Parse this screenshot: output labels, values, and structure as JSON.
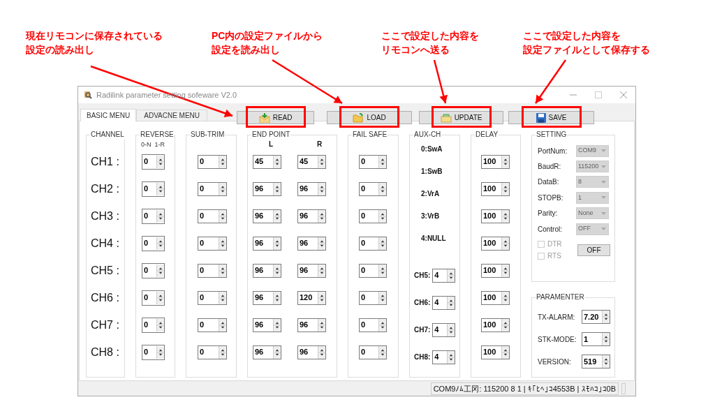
{
  "annotations": [
    {
      "lines": [
        "現在リモコンに保存されている",
        "設定の読み出し"
      ]
    },
    {
      "lines": [
        "PC内の設定ファイルから",
        "設定を読み出し"
      ]
    },
    {
      "lines": [
        "ここで設定した内容を",
        "リモコンへ送る"
      ]
    },
    {
      "lines": [
        "ここで設定した内容を",
        "設定ファイルとして保存する"
      ]
    }
  ],
  "window": {
    "title": "Radilink parameter setting sofeware V2.0"
  },
  "tabs": [
    {
      "label": "BASIC MENU",
      "selected": true
    },
    {
      "label": "ADVACNE MENU",
      "selected": false
    }
  ],
  "actions": [
    {
      "label": "READ",
      "kind": "read",
      "highlighted": true
    },
    {
      "label": "LOAD",
      "kind": "load",
      "highlighted": true
    },
    {
      "label": "UPDATE",
      "kind": "update",
      "highlighted": true
    },
    {
      "label": "SAVE",
      "kind": "save",
      "highlighted": true
    }
  ],
  "groups": {
    "channel": "CHANNEL",
    "reverse": "REVERSE",
    "reverse_hint": "0-N  1-R",
    "sub_trim": "SUB-TRIM",
    "end_point": "END POINT",
    "end_point_l": "L",
    "end_point_r": "R",
    "fail_safe": "FAIL SAFE",
    "aux_ch": "AUX-CH",
    "delay": "DELAY"
  },
  "channels": [
    {
      "label": "CH1 :",
      "reverse": "0",
      "sub_trim": "0",
      "end_point_l": "45",
      "end_point_r": "45",
      "fail_safe": "0",
      "delay": "100"
    },
    {
      "label": "CH2 :",
      "reverse": "0",
      "sub_trim": "0",
      "end_point_l": "96",
      "end_point_r": "96",
      "fail_safe": "0",
      "delay": "100"
    },
    {
      "label": "CH3 :",
      "reverse": "0",
      "sub_trim": "0",
      "end_point_l": "96",
      "end_point_r": "96",
      "fail_safe": "0",
      "delay": "100"
    },
    {
      "label": "CH4 :",
      "reverse": "0",
      "sub_trim": "0",
      "end_point_l": "96",
      "end_point_r": "96",
      "fail_safe": "0",
      "delay": "100"
    },
    {
      "label": "CH5 :",
      "reverse": "0",
      "sub_trim": "0",
      "end_point_l": "96",
      "end_point_r": "96",
      "fail_safe": "0",
      "delay": "100"
    },
    {
      "label": "CH6 :",
      "reverse": "0",
      "sub_trim": "0",
      "end_point_l": "96",
      "end_point_r": "120",
      "fail_safe": "0",
      "delay": "100"
    },
    {
      "label": "CH7 :",
      "reverse": "0",
      "sub_trim": "0",
      "end_point_l": "96",
      "end_point_r": "96",
      "fail_safe": "0",
      "delay": "100"
    },
    {
      "label": "CH8 :",
      "reverse": "0",
      "sub_trim": "0",
      "end_point_l": "96",
      "end_point_r": "96",
      "fail_safe": "0",
      "delay": "100"
    }
  ],
  "aux_ch": {
    "options": [
      "0:SwA",
      "1:SwB",
      "2:VrA",
      "3:VrB",
      "4:NULL"
    ],
    "assignments": [
      {
        "label": "CH5:",
        "value": "4"
      },
      {
        "label": "CH6:",
        "value": "4"
      },
      {
        "label": "CH7:",
        "value": "4"
      },
      {
        "label": "CH8:",
        "value": "4"
      }
    ]
  },
  "setting": {
    "title": "SETTING",
    "fields": [
      {
        "label": "PortNum:",
        "value": "COM9",
        "disabled": true
      },
      {
        "label": "BaudR:",
        "value": "115200",
        "disabled": true
      },
      {
        "label": "DataB:",
        "value": "8",
        "disabled": true
      },
      {
        "label": "STOPB:",
        "value": "1",
        "disabled": true
      },
      {
        "label": "Parity:",
        "value": "None",
        "disabled": true
      },
      {
        "label": "Control:",
        "value": "OFF",
        "disabled": true
      }
    ],
    "checkboxes": [
      {
        "label": "DTR",
        "checked": false,
        "disabled": true
      },
      {
        "label": "RTS",
        "checked": false,
        "disabled": true
      }
    ],
    "button": "OFF"
  },
  "parameter": {
    "title": "PARAMENTER",
    "fields": [
      {
        "label": "TX-ALARM:",
        "value": "7.20"
      },
      {
        "label": "STK-MODE:",
        "value": "1"
      },
      {
        "label": "VERSION:",
        "value": "519"
      }
    ]
  },
  "status_bar": {
    "text": "COM9ﾉﾑ工冈: 115200 8 1 | ｷ｢ﾋﾍ｣ｺ4553B | ｽﾓﾊｺ｣ｺ0B"
  }
}
